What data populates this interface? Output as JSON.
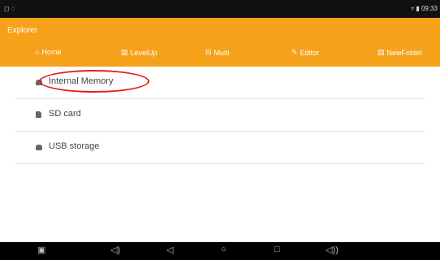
{
  "status": {
    "left": "◻ ◌",
    "right": "▿ ▮ 09:33"
  },
  "app": {
    "title": "Explorer"
  },
  "toolbar": {
    "home": "Home",
    "levelup": "LevelUp",
    "multi": "Multi",
    "editor": "Editor",
    "newfolder": "NewFolder"
  },
  "storage": [
    {
      "label": "Internal Memory"
    },
    {
      "label": "SD card"
    },
    {
      "label": "USB storage"
    }
  ],
  "nav": {
    "screenshot": "▣",
    "vol_down": "◁)",
    "back": "◁",
    "home": "○",
    "recent": "□",
    "vol_up": "◁))"
  },
  "colors": {
    "appbar": "#f6a11a",
    "highlight": "#e02020"
  }
}
